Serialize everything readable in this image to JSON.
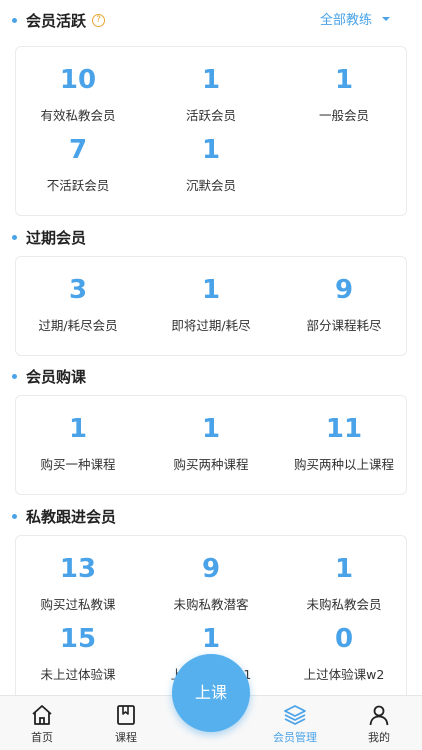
{
  "sections": [
    {
      "title": "会员活跃",
      "filter_label": "全部教练",
      "stats": [
        {
          "value": "10",
          "label": "有效私教会员"
        },
        {
          "value": "1",
          "label": "活跃会员"
        },
        {
          "value": "1",
          "label": "一般会员"
        },
        {
          "value": "7",
          "label": "不活跃会员"
        },
        {
          "value": "1",
          "label": "沉默会员"
        }
      ]
    },
    {
      "title": "过期会员",
      "stats": [
        {
          "value": "3",
          "label": "过期/耗尽会员"
        },
        {
          "value": "1",
          "label": "即将过期/耗尽"
        },
        {
          "value": "9",
          "label": "部分课程耗尽"
        }
      ]
    },
    {
      "title": "会员购课",
      "stats": [
        {
          "value": "1",
          "label": "购买一种课程"
        },
        {
          "value": "1",
          "label": "购买两种课程"
        },
        {
          "value": "11",
          "label": "购买两种以上课程"
        }
      ]
    },
    {
      "title": "私教跟进会员",
      "stats": [
        {
          "value": "13",
          "label": "购买过私教课"
        },
        {
          "value": "9",
          "label": "未购私教潜客"
        },
        {
          "value": "1",
          "label": "未购私教会员"
        },
        {
          "value": "15",
          "label": "未上过体验课"
        },
        {
          "value": "1",
          "label": "上过体验课w1"
        },
        {
          "value": "0",
          "label": "上过体验课w2"
        }
      ]
    }
  ],
  "help_glyph": "?",
  "tabbar": {
    "home": "首页",
    "course": "课程",
    "fab": "上课",
    "members": "会员管理",
    "mine": "我的"
  },
  "colors": {
    "accent": "#4aa3e8",
    "help": "#e8a634"
  }
}
